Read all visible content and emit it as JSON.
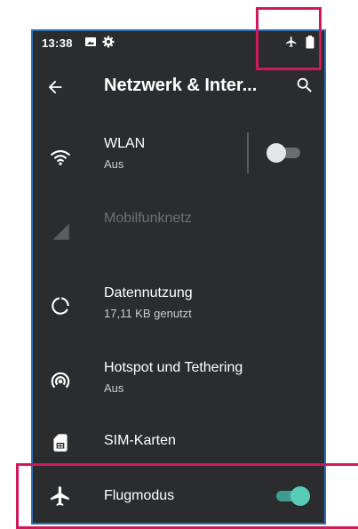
{
  "statusbar": {
    "time": "13:38"
  },
  "appbar": {
    "title": "Netzwerk & Inter..."
  },
  "rows": [
    {
      "title": "WLAN",
      "subtitle": "Aus"
    },
    {
      "title": "Mobilfunknetz"
    },
    {
      "title": "Datennutzung",
      "subtitle": "17,11 KB genutzt"
    },
    {
      "title": "Hotspot und Tethering",
      "subtitle": "Aus"
    },
    {
      "title": "SIM-Karten"
    },
    {
      "title": "Flugmodus"
    }
  ],
  "toggles": {
    "wlan_on": false,
    "flugmodus_on": true
  },
  "colors": {
    "highlight": "#d1185d",
    "accent": "#57cdb8",
    "background": "#2a2c2e",
    "frame": "#2d6fb3"
  }
}
